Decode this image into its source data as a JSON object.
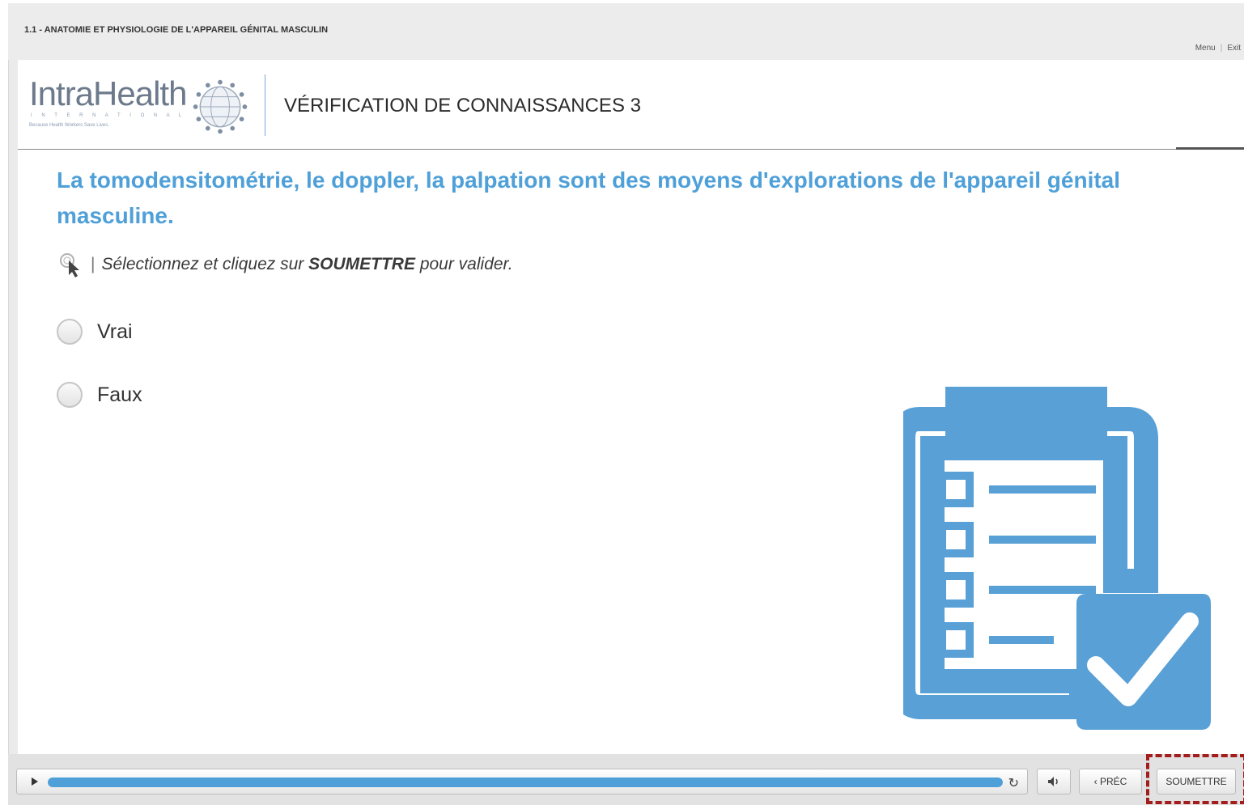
{
  "course": {
    "title": "1.1 - ANATOMIE ET PHYSIOLOGIE DE L'APPAREIL GÉNITAL MASCULIN",
    "menu_label": "Menu",
    "exit_label": "Exit"
  },
  "header": {
    "logo_text": "IntraHealth",
    "logo_subtitle": "I N T E R N A T I O N A L",
    "logo_tagline": "Because Health Workers Save Lives.",
    "section_title": "VÉRIFICATION DE CONNAISSANCES 3"
  },
  "quiz": {
    "question": "La tomodensitométrie, le doppler, la palpation sont des moyens d'explorations de l'appareil génital masculine.",
    "instruction_prefix": "Sélectionnez et cliquez sur",
    "instruction_bold": "SOUMETTRE",
    "instruction_suffix": "pour valider.",
    "options": [
      {
        "label": "Vrai",
        "selected": false
      },
      {
        "label": "Faux",
        "selected": false
      }
    ]
  },
  "player": {
    "progress": 1.0,
    "prev_label": "‹ PRÉC",
    "submit_label": "SOUMETTRE",
    "icons": [
      "play-icon",
      "replay-icon",
      "audio-icon"
    ]
  },
  "colors": {
    "accent": "#4fa0d8",
    "highlight_border": "#a31d1d"
  }
}
